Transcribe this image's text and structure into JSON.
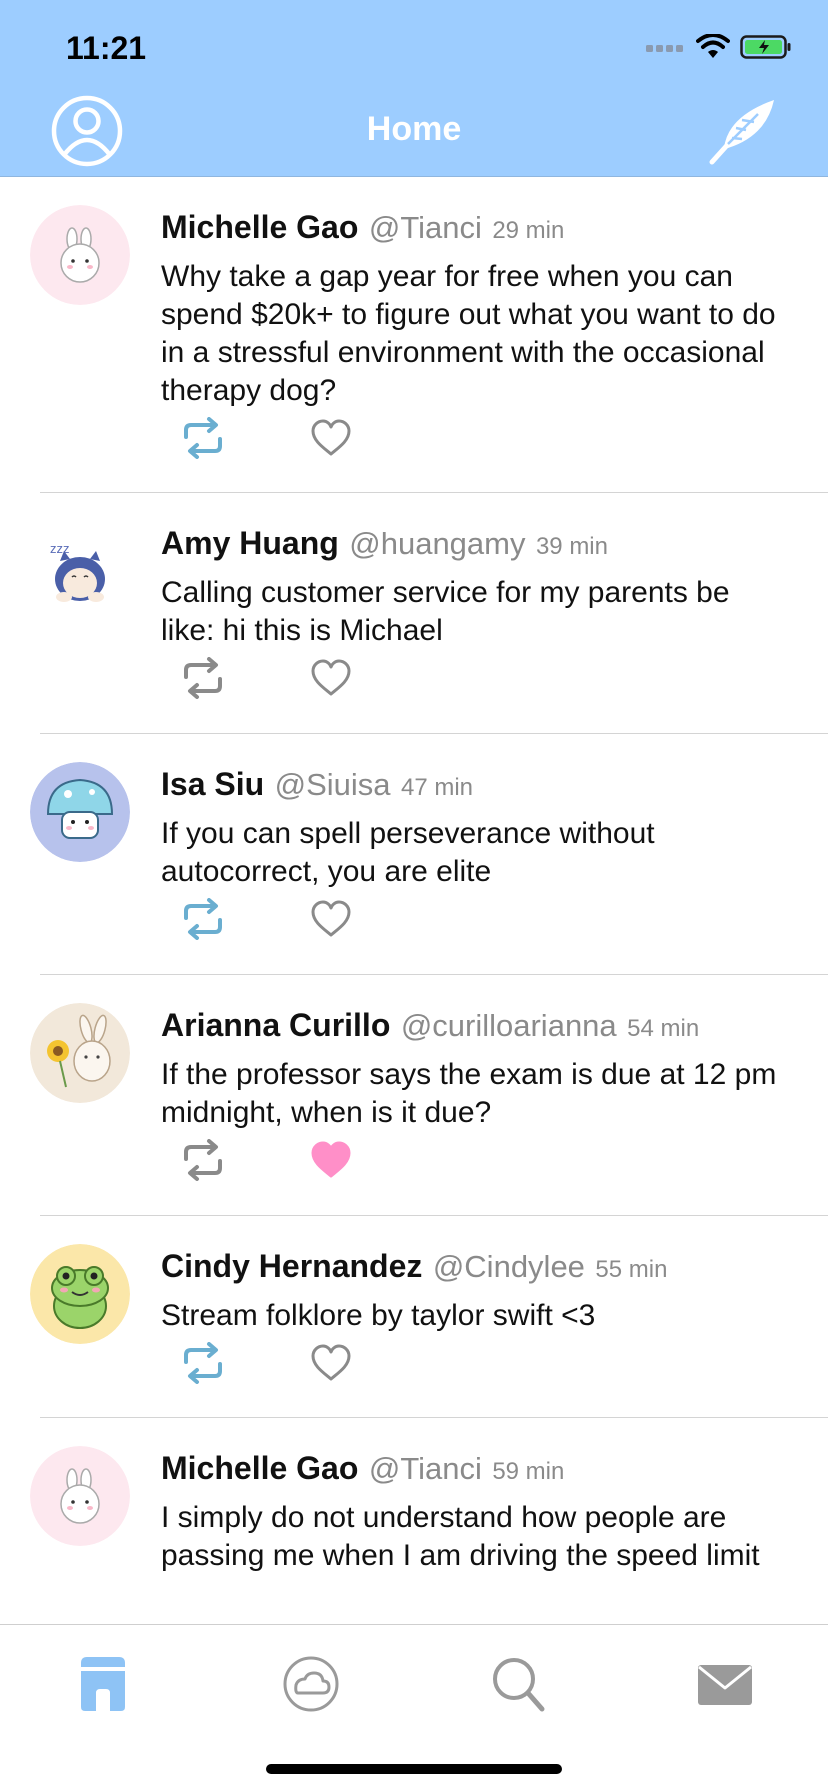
{
  "status_bar": {
    "time": "11:21"
  },
  "header": {
    "title": "Home"
  },
  "tweets": [
    {
      "name": "Michelle Gao",
      "handle": "@Tianci",
      "time": "29 min",
      "text": "Why take a gap year for free when you can spend $20k+ to figure out what you want to do in a stressful environment with the occasional therapy dog?",
      "retweeted": true,
      "liked": false,
      "avatar": "molang-bunny-avatar"
    },
    {
      "name": "Amy Huang",
      "handle": "@huangamy",
      "time": "39 min",
      "text": "Calling customer service for my parents be like: hi this is Michael",
      "retweeted": false,
      "liked": false,
      "avatar": "sleeping-snorlax-avatar"
    },
    {
      "name": "Isa Siu",
      "handle": "@Siuisa",
      "time": "47 min",
      "text": "If you can spell perseverance without autocorrect, you are elite",
      "retweeted": true,
      "liked": false,
      "avatar": "mushroom-character-avatar"
    },
    {
      "name": "Arianna Curillo",
      "handle": "@curilloarianna",
      "time": "54 min",
      "text": "If the professor says the exam is due at 12 pm midnight, when is it due?",
      "retweeted": false,
      "liked": true,
      "avatar": "bunny-sunflower-avatar"
    },
    {
      "name": "Cindy Hernandez",
      "handle": "@Cindylee",
      "time": "55 min",
      "text": "Stream folklore by taylor swift <3",
      "retweeted": true,
      "liked": false,
      "avatar": "green-frog-avatar"
    },
    {
      "name": "Michelle Gao",
      "handle": "@Tianci",
      "time": "59 min",
      "text": "I simply do not understand how people are passing me when I am driving the speed limit",
      "retweeted": false,
      "liked": false,
      "avatar": "molang-bunny-avatar"
    }
  ],
  "tab_bar": {
    "items": [
      {
        "icon": "home-icon",
        "selected": true
      },
      {
        "icon": "cloud-icon",
        "selected": false
      },
      {
        "icon": "search-icon",
        "selected": false
      },
      {
        "icon": "mail-icon",
        "selected": false
      }
    ]
  },
  "colors": {
    "header_bg": "#9dcdff",
    "retweet_active": "#6aaed0",
    "action_inactive": "#8a8a8a",
    "like_active": "#ff8fc8",
    "tab_selected": "#8ec3f5",
    "tab_unselected": "#9a9a9a"
  }
}
